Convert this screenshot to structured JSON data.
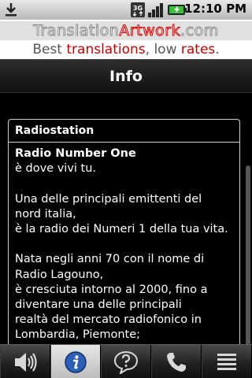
{
  "statusbar": {
    "time": "12:10 PM",
    "network_label": "3G",
    "icons": [
      "download-icon",
      "3g-icon",
      "signal-icon",
      "battery-icon"
    ]
  },
  "ad": {
    "line1_a": "Translation",
    "line1_b": "Artwork",
    "line1_c": ".com",
    "line2_a": "Best ",
    "line2_b": "translations",
    "line2_c": ", low ",
    "line2_d": "rates",
    "line2_e": "."
  },
  "header": {
    "title": "Info"
  },
  "panel": {
    "heading": "Radiostation",
    "station_name": "Radio Number One",
    "line_tagline": "è dove vivi tu.",
    "para2_l1": "Una delle principali emittenti del",
    "para2_l2": "nord italia,",
    "para2_l3": "è la radio dei Numeri 1 della tua vita.",
    "para3_l1": "Nata negli anni 70 con il nome di",
    "para3_l2": "Radio Lagouno,",
    "para3_l3": "è cresciuta intorno al 2000, fino a",
    "para3_l4": "diventare una delle principali",
    "para3_l5": "realtà del mercato radiofonico in",
    "para3_l6": "Lombardia, Piemonte;"
  },
  "tabs": [
    {
      "name": "audio",
      "icon": "speaker-icon",
      "active": false
    },
    {
      "name": "info",
      "icon": "info-icon",
      "active": true
    },
    {
      "name": "faq",
      "icon": "question-bubble-icon",
      "active": false
    },
    {
      "name": "call",
      "icon": "phone-icon",
      "active": false
    },
    {
      "name": "menu",
      "icon": "list-icon",
      "active": false
    }
  ],
  "colors": {
    "accent_red": "#c40000",
    "active_tab": "#d5d5d5",
    "info_blue": "#1f4fa8"
  }
}
